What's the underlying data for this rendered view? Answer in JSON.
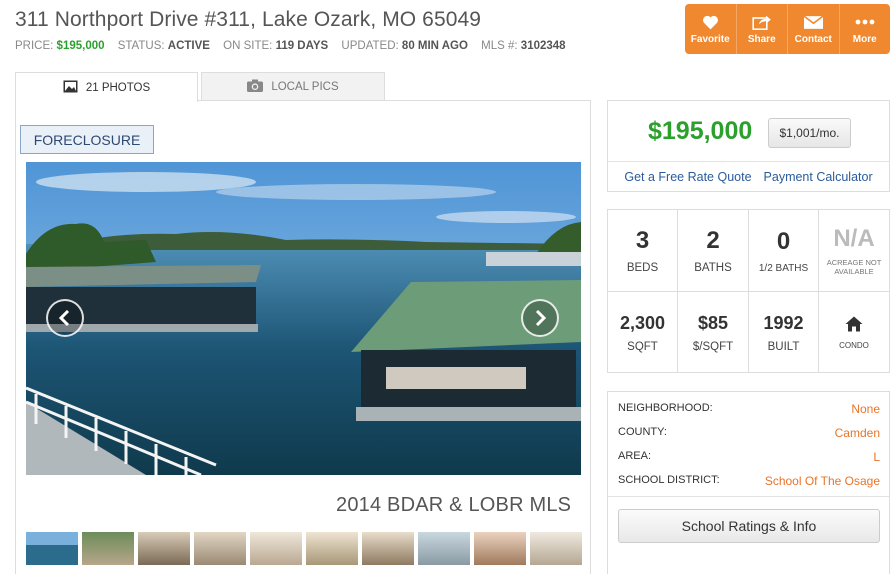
{
  "listing": {
    "title": "311 Northport Drive #311, Lake Ozark, MO 65049",
    "price_label": "PRICE:",
    "price": "$195,000",
    "status_label": "STATUS:",
    "status": "ACTIVE",
    "onsite_label": "ON SITE:",
    "onsite": "119 DAYS",
    "updated_label": "UPDATED:",
    "updated": "80 MIN AGO",
    "mls_label": "MLS #:",
    "mls": "3102348"
  },
  "actions": [
    {
      "label": "Favorite",
      "icon": "heart-icon"
    },
    {
      "label": "Share",
      "icon": "share-icon"
    },
    {
      "label": "Contact",
      "icon": "envelope-icon"
    },
    {
      "label": "More",
      "icon": "ellipsis-icon"
    }
  ],
  "tabs": [
    {
      "label": "21 PHOTOS",
      "icon": "image-icon",
      "active": true
    },
    {
      "label": "LOCAL PICS",
      "icon": "camera-icon",
      "active": false
    }
  ],
  "gallery": {
    "badge": "FORECLOSURE",
    "watermark": "2014 BDAR & LOBR MLS",
    "thumb_count": 10
  },
  "pricebox": {
    "price": "$195,000",
    "monthly": "$1,001/mo.",
    "rate_quote": "Get a Free Rate Quote",
    "calculator": "Payment Calculator"
  },
  "facts": [
    {
      "value": "3",
      "label": "BEDS"
    },
    {
      "value": "2",
      "label": "BATHS"
    },
    {
      "value": "0",
      "label": "1/2 BATHS"
    },
    {
      "value": "N/A",
      "label": "ACREAGE NOT AVAILABLE"
    },
    {
      "value": "2,300",
      "label": "SQFT"
    },
    {
      "value": "$85",
      "label": "$/SQFT"
    },
    {
      "value": "1992",
      "label": "BUILT"
    },
    {
      "value": "",
      "label": "CONDO",
      "icon": "home-icon"
    }
  ],
  "details": [
    {
      "key": "NEIGHBORHOOD:",
      "value": "None"
    },
    {
      "key": "COUNTY:",
      "value": "Camden"
    },
    {
      "key": "AREA:",
      "value": "L"
    },
    {
      "key": "SCHOOL DISTRICT:",
      "value": "School Of The Osage"
    }
  ],
  "school_button": "School Ratings & Info",
  "colors": {
    "accent": "#f0882f",
    "price_green": "#2ca02c",
    "link_blue": "#2a5b9c",
    "value_orange": "#e8742a"
  }
}
